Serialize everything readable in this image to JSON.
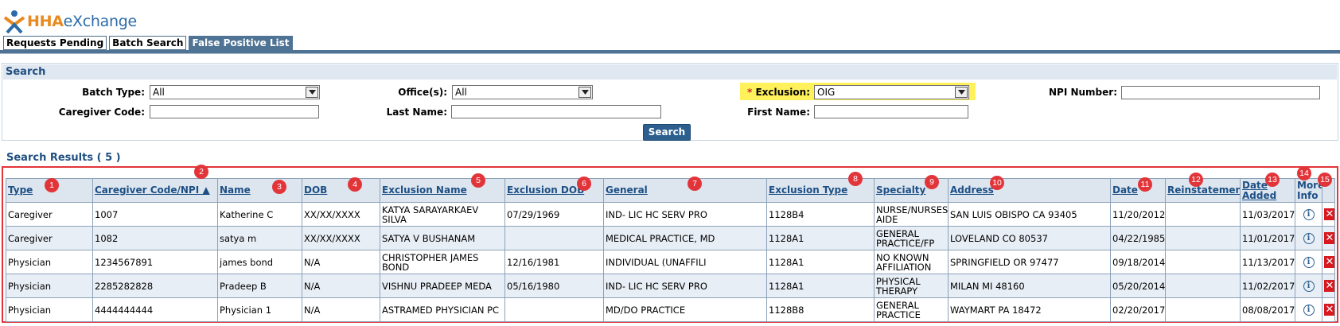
{
  "brand": {
    "part1": "HHA",
    "part2": "eXchange"
  },
  "tabs": [
    {
      "label": "Requests Pending"
    },
    {
      "label": "Batch Search"
    },
    {
      "label": "False Positive List"
    }
  ],
  "search": {
    "title": "Search",
    "batch_type_label": "Batch Type:",
    "batch_type_value": "All",
    "offices_label": "Office(s):",
    "offices_value": "All",
    "exclusion_required": "*",
    "exclusion_label": "Exclusion:",
    "exclusion_value": "OIG",
    "npi_label": "NPI Number:",
    "npi_value": "",
    "caregiver_code_label": "Caregiver Code:",
    "caregiver_code_value": "",
    "last_name_label": "Last Name:",
    "last_name_value": "",
    "first_name_label": "First Name:",
    "first_name_value": "",
    "button_label": "Search"
  },
  "results": {
    "title": "Search Results ( 5 )",
    "columns": [
      "Type",
      "Caregiver Code/NPI ▲",
      "Name",
      "DOB",
      "Exclusion Name",
      "Exclusion DOB",
      "General",
      "Exclusion Type",
      "Specialty",
      "Address",
      "Date",
      "Reinstatement",
      "Date Added",
      "More Info",
      ""
    ],
    "badges": [
      "1",
      "2",
      "3",
      "4",
      "5",
      "6",
      "7",
      "8",
      "9",
      "10",
      "11",
      "12",
      "13",
      "14",
      "15"
    ],
    "rows": [
      [
        "Caregiver",
        "1007",
        "Katherine C",
        "XX/XX/XXXX",
        "KATYA SARAYARKAEV SILVA",
        "07/29/1969",
        "IND- LIC HC SERV PRO",
        "1128B4",
        "NURSE/NURSES AIDE",
        "SAN LUIS OBISPO CA 93405",
        "11/20/2012",
        "",
        "11/03/2017"
      ],
      [
        "Caregiver",
        "1082",
        "satya m",
        "XX/XX/XXXX",
        "SATYA V BUSHANAM",
        "",
        "MEDICAL PRACTICE, MD",
        "1128A1",
        "GENERAL PRACTICE/FP",
        "LOVELAND CO 80537",
        "04/22/1985",
        "",
        "11/01/2017"
      ],
      [
        "Physician",
        "1234567891",
        "james bond",
        "N/A",
        "CHRISTOPHER JAMES BOND",
        "12/16/1981",
        "INDIVIDUAL (UNAFFILI",
        "1128A1",
        "NO KNOWN AFFILIATION",
        "SPRINGFIELD OR 97477",
        "09/18/2014",
        "",
        "11/13/2017"
      ],
      [
        "Physician",
        "2285282828",
        "Pradeep B",
        "N/A",
        "VISHNU PRADEEP MEDA",
        "05/16/1980",
        "IND- LIC HC SERV PRO",
        "1128A1",
        "PHYSICAL THERAPY",
        "MILAN MI 48160",
        "05/20/2014",
        "",
        "11/02/2017"
      ],
      [
        "Physician",
        "4444444444",
        "Physician 1",
        "N/A",
        "ASTRAMED PHYSICIAN PC",
        "",
        "MD/DO PRACTICE",
        "1128B8",
        "GENERAL PRACTICE",
        "WAYMART PA 18472",
        "02/20/2017",
        "",
        "08/08/2017"
      ]
    ],
    "info_icon": "i",
    "delete_icon": "✕"
  },
  "colors": {
    "accent": "#4f7394",
    "highlight": "#fff15c",
    "annotation": "#e2353a"
  }
}
